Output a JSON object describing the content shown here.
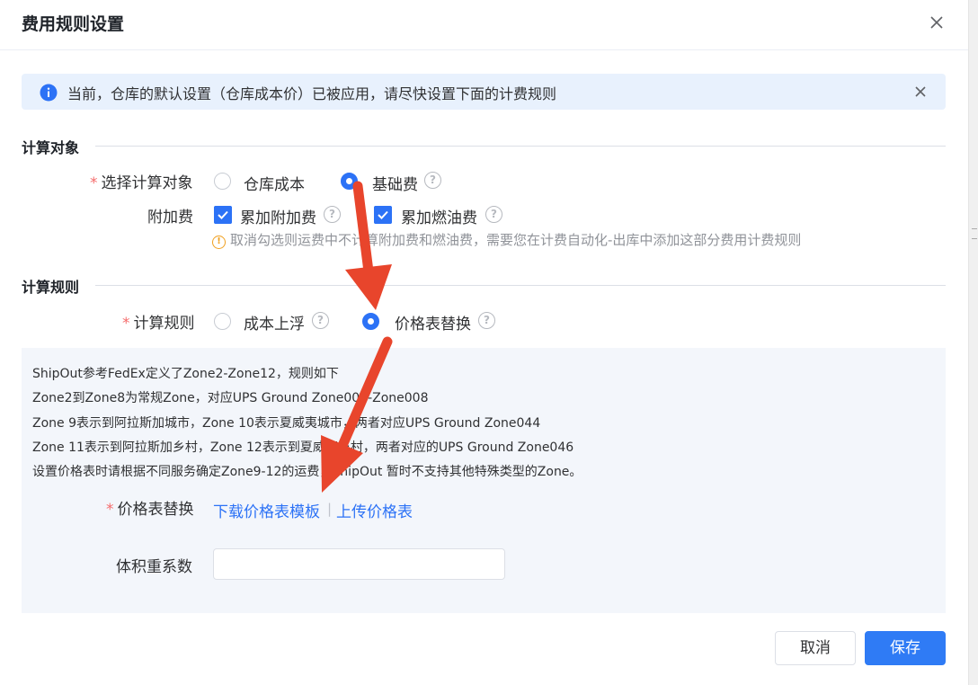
{
  "dialog": {
    "title": "费用规则设置"
  },
  "alert": {
    "message": "当前，仓库的默认设置（仓库成本价）已被应用，请尽快设置下面的计费规则"
  },
  "calc_target": {
    "section_title": "计算对象",
    "select_label": "选择计算对象",
    "options": [
      "仓库成本",
      "基础费"
    ],
    "selected": "基础费",
    "surcharge_label": "附加费",
    "checkboxes": [
      {
        "label": "累加附加费",
        "checked": true
      },
      {
        "label": "累加燃油费",
        "checked": true
      }
    ],
    "tip": "取消勾选则运费中不计算附加费和燃油费，需要您在计费自动化-出库中添加这部分费用计费规则"
  },
  "calc_rule": {
    "section_title": "计算规则",
    "rule_label": "计算规则",
    "options": [
      "成本上浮",
      "价格表替换"
    ],
    "selected": "价格表替换"
  },
  "panel": {
    "lines": [
      "ShipOut参考FedEx定义了Zone2-Zone12，规则如下",
      "Zone2到Zone8为常规Zone，对应UPS Ground Zone002-Zone008",
      "Zone 9表示到阿拉斯加城市，Zone 10表示夏威夷城市，两者对应UPS Ground Zone044",
      "Zone 11表示到阿拉斯加乡村，Zone 12表示到夏威夷乡村，两者对应的UPS Ground Zone046",
      "设置价格表时请根据不同服务确定Zone9-12的运费，ShipOut 暂时不支持其他特殊类型的Zone。"
    ],
    "price_table_label": "价格表替换",
    "download_link": "下载价格表模板",
    "separator": "|",
    "upload_link": "上传价格表",
    "volume_label": "体积重系数",
    "volume_value": ""
  },
  "footer": {
    "cancel": "取消",
    "save": "保存"
  },
  "colors": {
    "primary": "#2c72f6",
    "annotation_arrow": "#e8452c",
    "required": "#f56c6c",
    "warning": "#f0a020"
  }
}
